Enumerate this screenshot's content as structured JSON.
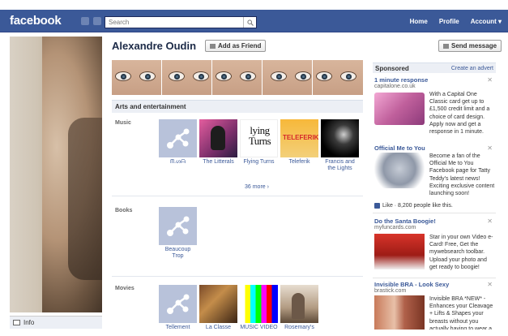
{
  "topbar": {
    "logo": "facebook",
    "search_placeholder": "Search",
    "nav": [
      "Home",
      "Profile",
      "Account ▾"
    ]
  },
  "profile": {
    "name": "Alexandre Oudin",
    "add_friend_label": "Add as Friend",
    "send_message_label": "Send message",
    "info_label": "Info"
  },
  "interests": {
    "section_title": "Arts and entertainment",
    "categories": [
      {
        "label": "Music",
        "items": [
          "ᗰ.ᔕᗩ",
          "The Litterals",
          "Flying Turns",
          "Teleferik",
          "Francis and the Lights"
        ],
        "more": "36 more ›"
      },
      {
        "label": "Books",
        "items": [
          "Beaucoup Trop"
        ]
      },
      {
        "label": "Movies",
        "items": [
          "Tellement",
          "La Classe",
          "MUSIC VIDEO",
          "Rosemary's"
        ]
      }
    ]
  },
  "tile_art": {
    "flying_turns_text": "lying Turns",
    "teleferik_text": "TELEFERIK"
  },
  "sidebar": {
    "title": "Sponsored",
    "create_ad": "Create an advert",
    "ads": [
      {
        "title": "1 minute response",
        "url": "capitalone.co.uk",
        "text": "With a Capital One Classic card get up to £1,500 credit limit and a choice of card design. Apply now and get a response in 1 minute."
      },
      {
        "title": "Official Me to You",
        "url": "",
        "text": "Become a fan of the Official Me to You Facebook page for Tatty Teddy's latest news! Exciting exclusive content launching soon!",
        "like_text": "Like · 8,200 people like this."
      },
      {
        "title": "Do the Santa Boogie!",
        "url": "myfuncards.com",
        "text": "Star in your own Video e-Card! Free, Get the mywebsearch toolbar. Upload your photo and get ready to boogie!"
      },
      {
        "title": "Invisible BRA - Look Sexy",
        "url": "brastick.com",
        "text": "Invisible BRA *NEW* - Enhances your Cleavage + Lifts & Shapes your breasts without you actually having to wear a"
      }
    ]
  },
  "colors": {
    "brand_blue": "#3b5998",
    "placeholder_tile": "#b8c2da"
  }
}
